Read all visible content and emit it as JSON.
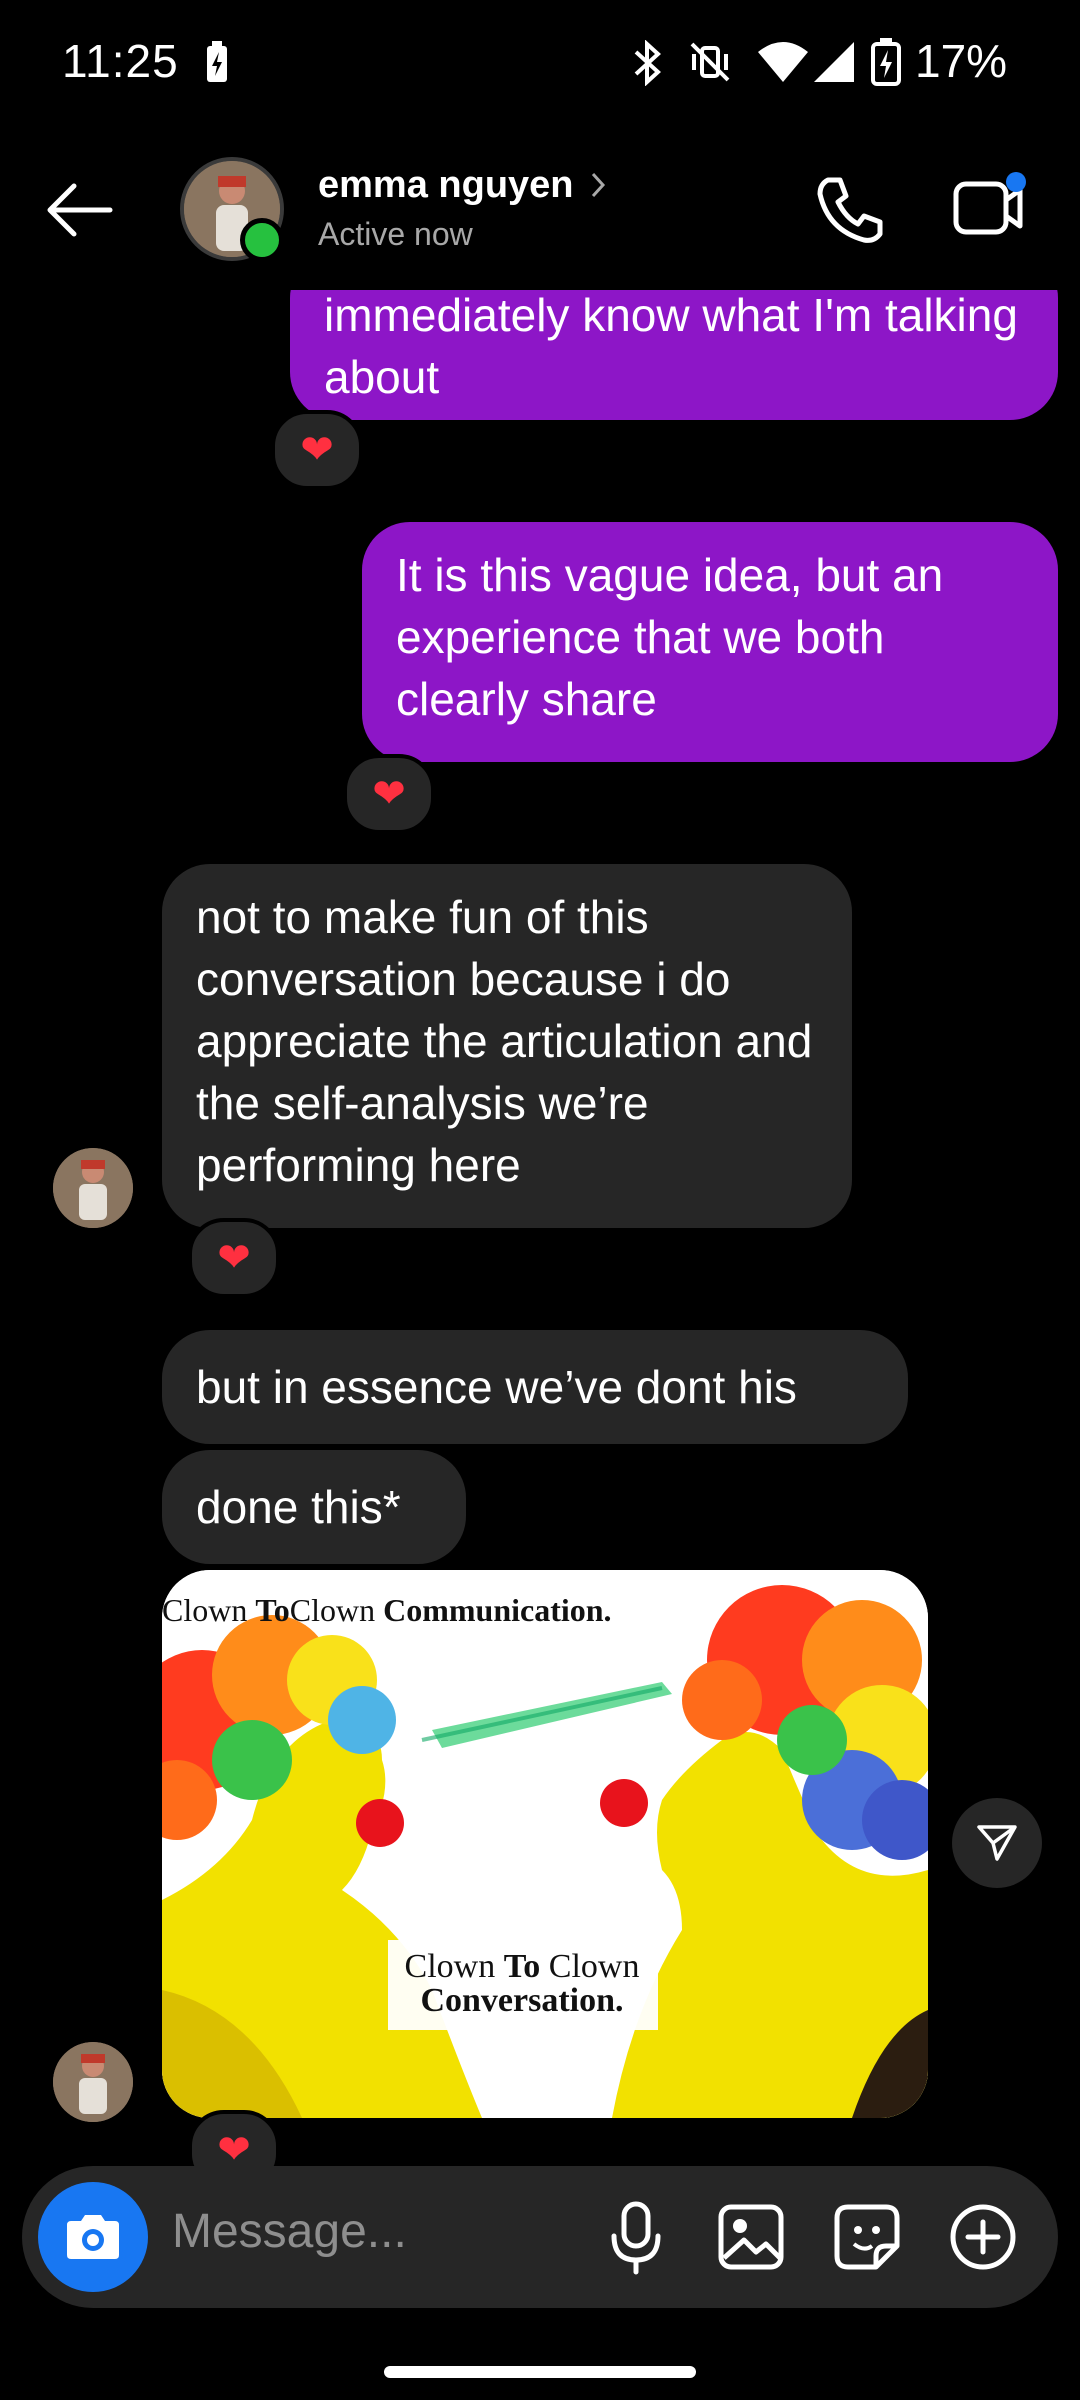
{
  "status_bar": {
    "time": "11:25",
    "battery": "17%"
  },
  "header": {
    "name": "emma nguyen",
    "status": "Active now"
  },
  "messages": {
    "m1": "immediately know what I'm talking about",
    "m2": "It is this vague idea, but an experience that we both clearly share",
    "m3": "not to make fun of this conversation because i do appreciate the articulation and the self-analysis we’re performing here",
    "m4": "but in essence we’ve dont his",
    "m5": "done this*"
  },
  "image": {
    "title_parts": [
      "Clown",
      "To",
      "Clown",
      "Communication."
    ],
    "caption_line1_parts": [
      "Clown",
      "To",
      "Clown"
    ],
    "caption_line2": "Conversation."
  },
  "reactions": {
    "emoji": "❤"
  },
  "composer": {
    "placeholder": "Message..."
  },
  "colors": {
    "outgoing": "#8d16c7",
    "incoming": "#262626",
    "accent": "#1877f2",
    "online": "#26c13f"
  }
}
